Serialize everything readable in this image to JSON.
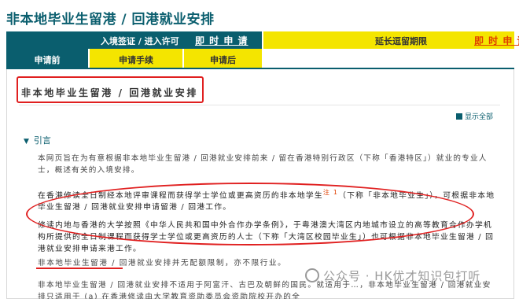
{
  "page": {
    "title": "非本地毕业生留港 / 回港就业安排"
  },
  "tabs": {
    "entry_label": "入境签证 / 进入许可",
    "entry_apply": "即 时 申 请",
    "extend_label": "延长逗留期限",
    "extend_apply": "即 时 申 请",
    "sub": [
      "申请前",
      "申请手续",
      "申请后"
    ]
  },
  "section": {
    "title": "非本地毕业生留港 / 回港就业安排",
    "show_all": "显示全部",
    "intro": "引言"
  },
  "paragraphs": {
    "p1": "本网页旨在为有意根据非本地毕业生留港 / 回港就业安排前来 / 留在香港特别行政区（下称「香港特区」）就业的专业人士，概述有关的入境安排。",
    "p2a": "在香港修读全日制经本地评审课程而获得学士学位或更高资历的非本地学生",
    "p2_note": "注 1",
    "p2b": "（下称「非本地毕业生」），可根据非本地毕业生留港 / 回港就业安排申请留港 / 回港工作。",
    "p3": "修读内地与香港的大学按照《中华人民共和国中外合作办学条例》，于粤港澳大湾区内地城市设立的高等教育合作办学机构所提供的全日制课程而获得学士学位或更高资历的人士（下称「大湾区校园毕业生」）也可根据非本地毕业生留港 / 回港就业安排申请来港工作。",
    "p4_head": "非本地毕业生留港",
    "p4_tail": " / 回港就业安排并无配额限制，亦不限行业。",
    "p5": "非本地毕业生留港 / 回港就业安排不适用于阿富汗、古巴及朝鲜的国民。就适用于…，非本地毕业生留港 / 回港就业安排只适用于 (a) 在香港修读由大学教育资助委员会资助院校开办的全"
  },
  "watermark": {
    "text": "公众号 · HK优才知识包打听"
  },
  "colors": {
    "teal": "#0a5e6e",
    "yellow": "#f4e500",
    "accent_red": "#e04000",
    "annotation_red": "#e02020"
  }
}
